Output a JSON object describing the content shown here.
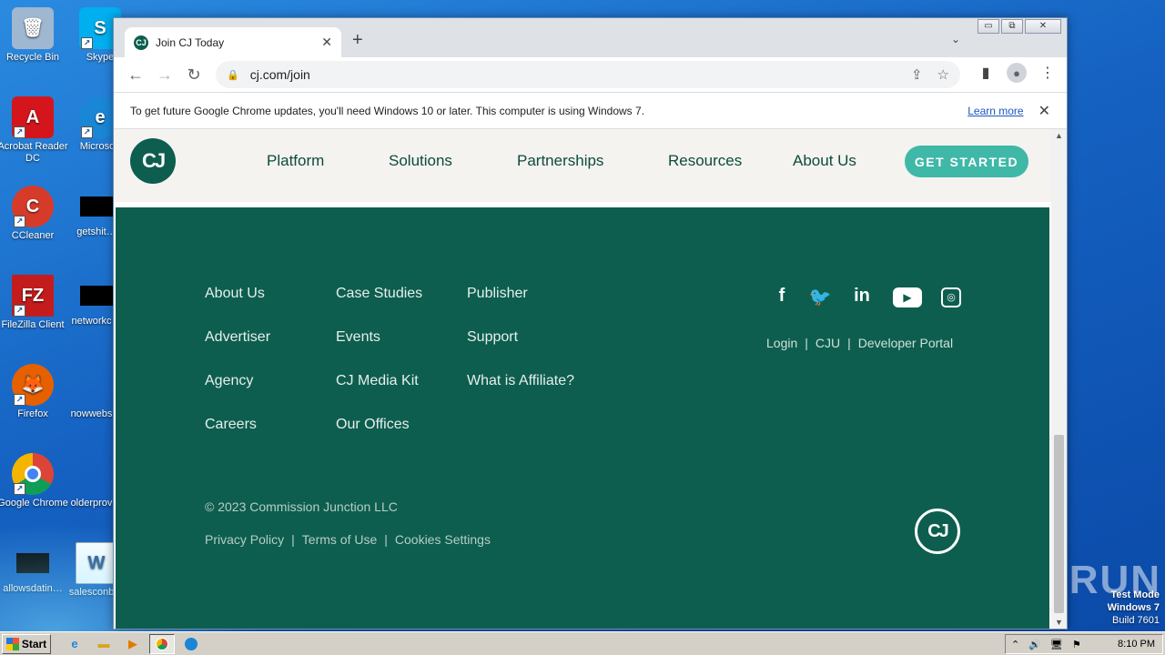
{
  "desktop": {
    "icons": [
      {
        "label": "Recycle Bin",
        "glyph": "🗑",
        "color": "#9fb7d0"
      },
      {
        "label": "Skype",
        "glyph": "S",
        "color": "#00aff0"
      },
      {
        "label": "Acrobat Reader DC",
        "glyph": "A",
        "color": "#d4151c"
      },
      {
        "label": "Microsoft",
        "glyph": "e",
        "color": "#1a86d6"
      },
      {
        "label": "CCleaner",
        "glyph": "C",
        "color": "#d63b2a"
      },
      {
        "label": "getshit…",
        "glyph": "",
        "color": "#000000"
      },
      {
        "label": "FileZilla Client",
        "glyph": "FZ",
        "color": "#c41c1c"
      },
      {
        "label": "networkc…",
        "glyph": "",
        "color": "#000000"
      },
      {
        "label": "Firefox",
        "glyph": "🦊",
        "color": "#e66000"
      },
      {
        "label": "nowwebs…",
        "glyph": "",
        "color": "#1562c2"
      },
      {
        "label": "Google Chrome",
        "glyph": "◉",
        "color": "#db4437"
      },
      {
        "label": "olderprov…",
        "glyph": "",
        "color": "#1562c2"
      },
      {
        "label": "allowsdatin…",
        "glyph": "",
        "color": "#000000"
      },
      {
        "label": "salesconb…",
        "glyph": "W",
        "color": "#2b5797"
      }
    ],
    "watermark": {
      "line1": "Test Mode",
      "line2": "Windows 7",
      "line3": "Build 7601"
    },
    "brand_watermark": "ANY▷RUN"
  },
  "browser": {
    "tab_title": "Join CJ Today",
    "tab_close": "✕",
    "new_tab": "+",
    "tab_dropdown": "⌄",
    "window_controls": {
      "minimize": "▭",
      "restore": "⧉",
      "close": "✕"
    },
    "url": "cj.com/join",
    "infobar": {
      "message": "To get future Google Chrome updates, you'll need Windows 10 or later. This computer is using Windows 7.",
      "link": "Learn more",
      "dismiss": "✕"
    }
  },
  "site": {
    "logo": "CJ",
    "nav": [
      "Platform",
      "Solutions",
      "Partnerships",
      "Resources",
      "About Us"
    ],
    "cta": "GET STARTED",
    "footer": {
      "col1": [
        "About Us",
        "Advertiser",
        "Agency",
        "Careers"
      ],
      "col2": [
        "Case Studies",
        "Events",
        "CJ Media Kit",
        "Our Offices"
      ],
      "col3": [
        "Publisher",
        "Support",
        "What is Affiliate?"
      ],
      "social": {
        "facebook": "f",
        "twitter": "🐦",
        "linkedin": "in",
        "youtube": "▶",
        "instagram": "◎"
      },
      "portal_links": [
        "Login",
        "CJU",
        "Developer Portal"
      ],
      "copyright": "© 2023 Commission Junction LLC",
      "legal_links": [
        "Privacy Policy",
        "Terms of Use",
        "Cookies Settings"
      ],
      "separator": "|"
    }
  },
  "taskbar": {
    "start": "Start",
    "clock": "8:10 PM",
    "tray_icons": [
      "⌃",
      "🔊",
      "🖥",
      "⚑"
    ]
  }
}
